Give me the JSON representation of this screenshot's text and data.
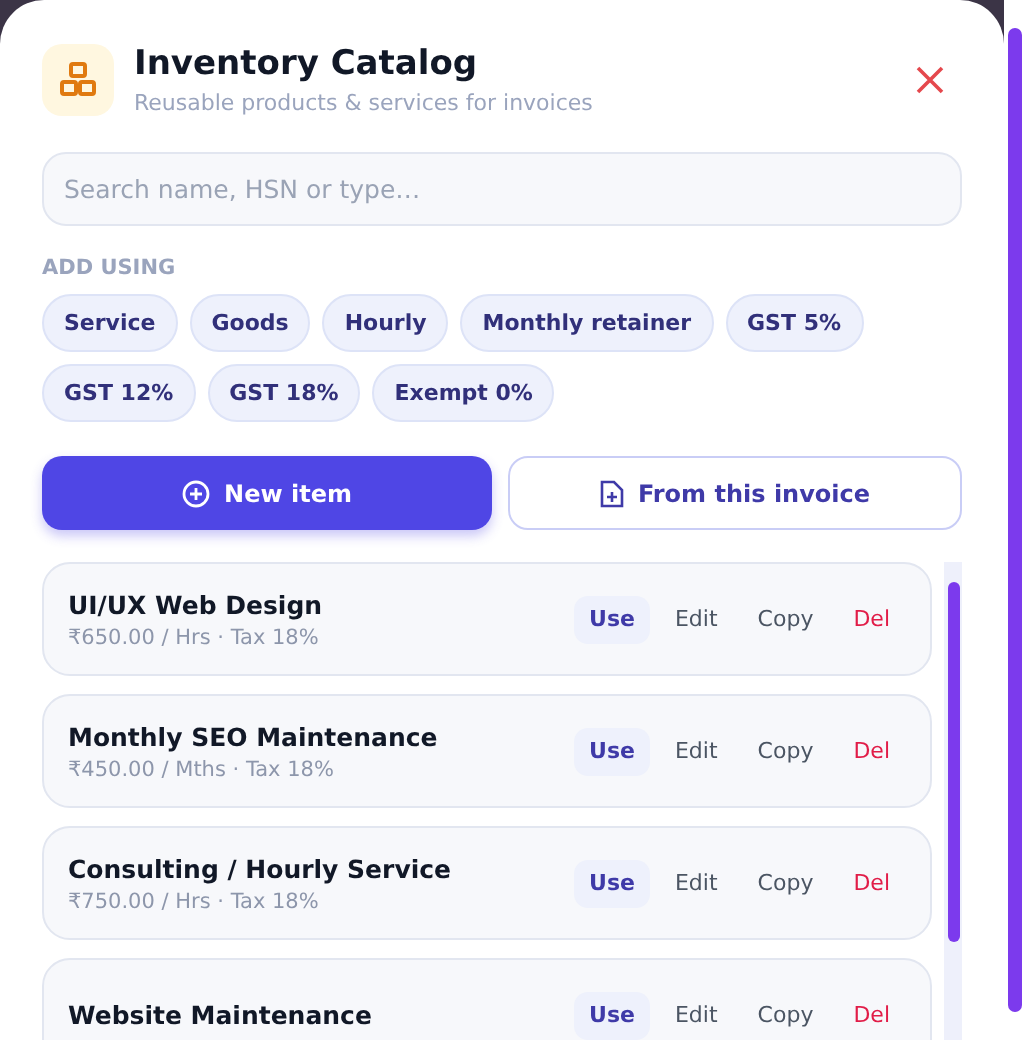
{
  "header": {
    "title": "Inventory Catalog",
    "subtitle": "Reusable products & services for invoices"
  },
  "search": {
    "placeholder": "Search name, HSN or type…"
  },
  "add_using": {
    "label": "ADD USING",
    "chips": [
      "Service",
      "Goods",
      "Hourly",
      "Monthly retainer",
      "GST 5%",
      "GST 12%",
      "GST 18%",
      "Exempt 0%"
    ]
  },
  "buttons": [
    {
      "label": "New item",
      "kind": "primary"
    },
    {
      "label": "From this invoice",
      "kind": "secondary"
    }
  ],
  "items": [
    {
      "name": "UI/UX Web Design",
      "meta": "₹650.00 / Hrs · Tax 18%",
      "actions": [
        {
          "label": "Use",
          "kind": "use"
        },
        {
          "label": "Edit",
          "kind": "plain"
        },
        {
          "label": "Copy",
          "kind": "plain"
        },
        {
          "label": "Del",
          "kind": "danger"
        }
      ]
    },
    {
      "name": "Monthly SEO Maintenance",
      "meta": "₹450.00 / Mths · Tax 18%",
      "actions": [
        {
          "label": "Use",
          "kind": "use"
        },
        {
          "label": "Edit",
          "kind": "plain"
        },
        {
          "label": "Copy",
          "kind": "plain"
        },
        {
          "label": "Del",
          "kind": "danger"
        }
      ]
    },
    {
      "name": "Consulting / Hourly Service",
      "meta": "₹750.00 / Hrs · Tax 18%",
      "actions": [
        {
          "label": "Use",
          "kind": "use"
        },
        {
          "label": "Edit",
          "kind": "plain"
        },
        {
          "label": "Copy",
          "kind": "plain"
        },
        {
          "label": "Del",
          "kind": "danger"
        }
      ]
    },
    {
      "name": "Website Maintenance",
      "actions": [
        {
          "label": "Use",
          "kind": "use"
        },
        {
          "label": "Edit",
          "kind": "plain"
        },
        {
          "label": "Copy",
          "kind": "plain"
        },
        {
          "label": "Del",
          "kind": "danger"
        }
      ]
    }
  ]
}
